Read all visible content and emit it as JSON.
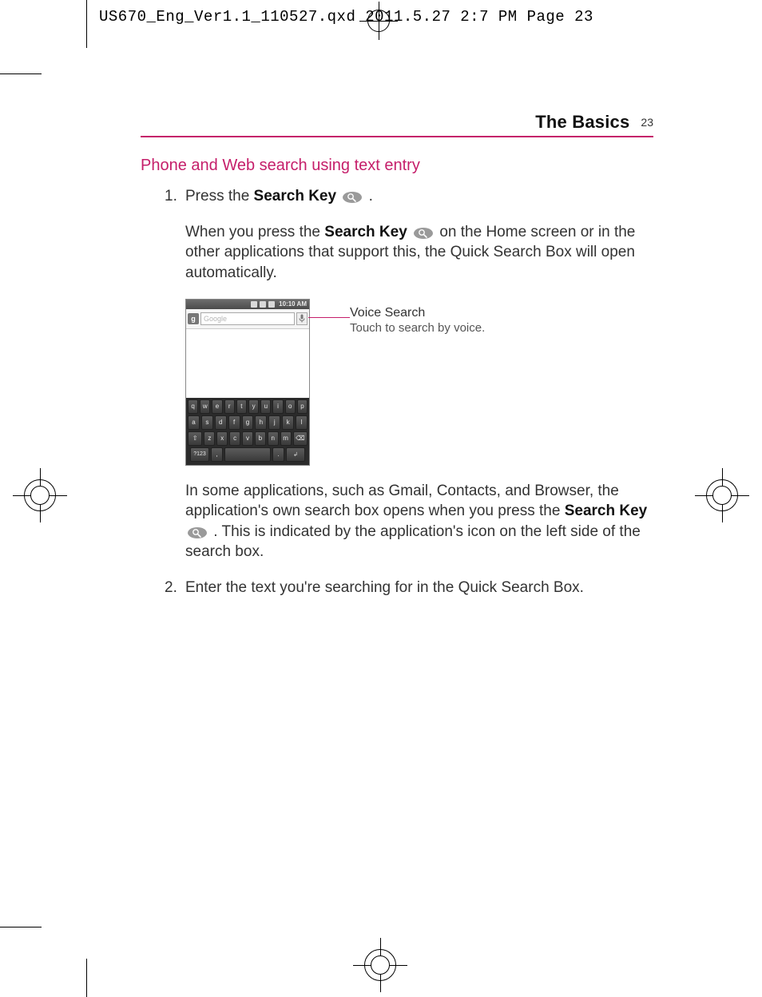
{
  "slug": "US670_Eng_Ver1.1_110527.qxd  2011.5.27  2:7 PM  Page 23",
  "runhead": {
    "title": "The Basics",
    "page": "23"
  },
  "heading": "Phone and Web search using text entry",
  "steps": {
    "s1": {
      "num": "1.",
      "lead": "Press the ",
      "keyLabel": "Search Key",
      "tail": " .",
      "para_a": "When you press the ",
      "para_b": " on the Home screen or in the other applications that support this, the Quick Search Box will open automatically."
    },
    "after1": {
      "a": "In some applications, such as Gmail, Contacts, and Browser, the application's own search box opens when you press the ",
      "b": " . This is indicated by the application's icon on the left side of the search box."
    },
    "s2": {
      "num": "2.",
      "text": "Enter the text you're searching for in the Quick Search Box."
    }
  },
  "callout": {
    "title": "Voice Search",
    "desc": "Touch to search by voice."
  },
  "phone": {
    "clock": "10:10 AM",
    "placeholder": "Google",
    "rows": {
      "r1": [
        "q",
        "w",
        "e",
        "r",
        "t",
        "y",
        "u",
        "i",
        "o",
        "p"
      ],
      "r2": [
        "a",
        "s",
        "d",
        "f",
        "g",
        "h",
        "j",
        "k",
        "l"
      ],
      "r3_mid": [
        "z",
        "x",
        "c",
        "v",
        "b",
        "n",
        "m"
      ],
      "sym": "?123",
      "enter": "↲",
      "dot": "."
    }
  }
}
